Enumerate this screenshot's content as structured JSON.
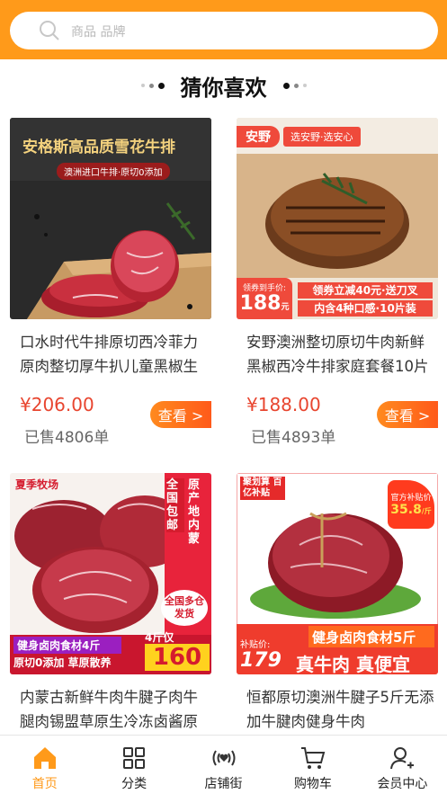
{
  "search": {
    "placeholder": "商品 品牌"
  },
  "section": {
    "title": "猜你喜欢"
  },
  "products": [
    {
      "title": "口水时代牛排原切西冷菲力原肉整切厚牛扒儿童黑椒生",
      "price": "¥206.00",
      "sold": "已售4806单",
      "button": "查看 >",
      "banner": "安格斯高品质雪花牛排",
      "tag": "澳洲进口牛排·原切0添加"
    },
    {
      "title": "安野澳洲整切原切牛肉新鲜黑椒西冷牛排家庭套餐10片",
      "price": "¥188.00",
      "sold": "已售4893单",
      "button": "查看 >",
      "brand": "安野",
      "slogan": "选安野·选安心",
      "promo_label": "领券到手价:",
      "promo_price": "188",
      "promo_unit": "元",
      "promo_line1": "领券立减40元·送刀叉",
      "promo_line2": "内含4种口感·10片装"
    },
    {
      "title": "内蒙古新鲜牛肉牛腱子肉牛腿肉锡盟草原生冷冻卤酱原",
      "price": "",
      "sold": "",
      "button": "",
      "brand": "夏季牧场",
      "badge": "全国包邮",
      "side": "原产地内蒙",
      "stamp": "全国多仓发货",
      "line1": "健身卤肉食材4斤",
      "line2": "原切0添加 草原散养",
      "count": "4斤仅",
      "promo_price": "160"
    },
    {
      "title": "恒都原切澳洲牛腱子5斤无添加牛腱肉健身牛肉",
      "price": "",
      "sold": "",
      "button": "",
      "brand": "聚划算 百亿补贴",
      "subsidy": "官方补贴价",
      "subsidy_price": "35.8",
      "subsidy_unit": "/斤",
      "banner": "健身卤肉食材5斤",
      "sub_label": "补贴价:",
      "sub_price": "179",
      "line": "真牛肉 真便宜"
    }
  ],
  "tabbar": [
    {
      "label": "首页",
      "icon": "home-icon",
      "active": true
    },
    {
      "label": "分类",
      "icon": "category-icon",
      "active": false
    },
    {
      "label": "店铺街",
      "icon": "store-street-icon",
      "active": false
    },
    {
      "label": "购物车",
      "icon": "cart-icon",
      "active": false
    },
    {
      "label": "会员中心",
      "icon": "member-icon",
      "active": false
    }
  ],
  "colors": {
    "accent": "#ff9a1a",
    "price": "#e8452f"
  }
}
